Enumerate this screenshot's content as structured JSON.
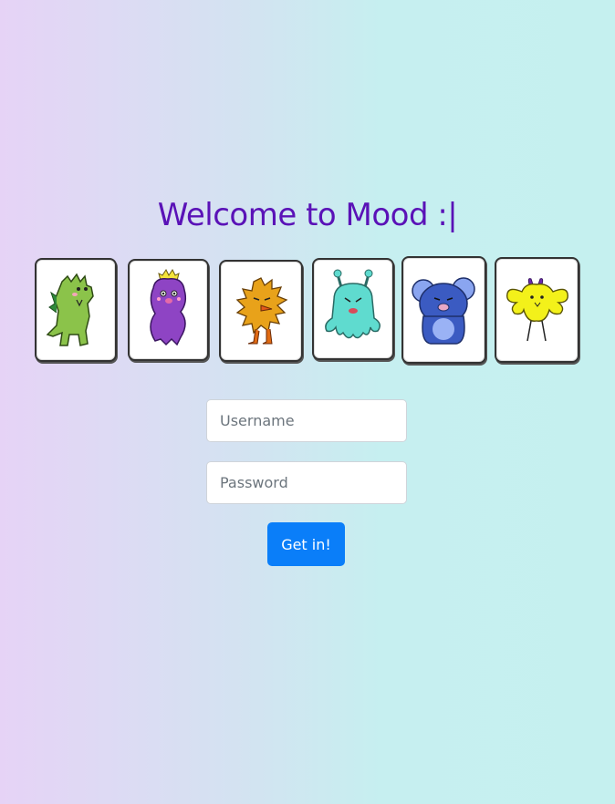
{
  "page": {
    "title": "Welcome to Mood :|"
  },
  "monsters": [
    {
      "icon": "green-dino-icon",
      "color": "#8bc34a"
    },
    {
      "icon": "purple-monster-icon",
      "color": "#8e44c4"
    },
    {
      "icon": "orange-fuzzy-monster-icon",
      "color": "#e8a21a"
    },
    {
      "icon": "teal-alien-icon",
      "color": "#5fdbcf"
    },
    {
      "icon": "blue-koala-icon",
      "color": "#3b5bc2"
    },
    {
      "icon": "yellow-bird-icon",
      "color": "#f3f11a"
    }
  ],
  "form": {
    "username_placeholder": "Username",
    "password_placeholder": "Password",
    "submit_label": "Get in!"
  },
  "colors": {
    "title": "#5a12b7",
    "button": "#0a7ef9"
  }
}
